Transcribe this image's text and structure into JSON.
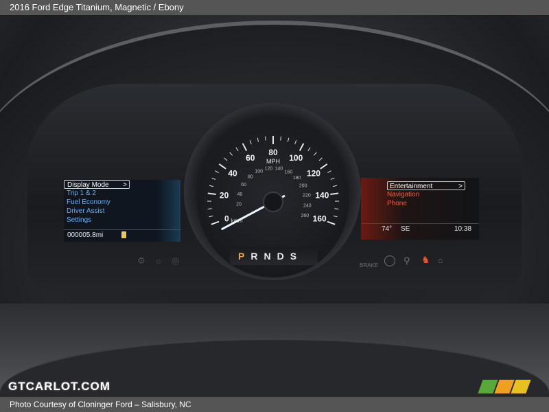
{
  "header": {
    "title": "2016 Ford Edge Titanium,   Magnetic / Ebony"
  },
  "footer": {
    "credit": "Photo Courtesy of Cloninger Ford – Salisbury, NC"
  },
  "watermark": {
    "text": "GTCARLOT.COM"
  },
  "left_display": {
    "menu": [
      "Display Mode",
      "Trip 1 & 2",
      "Fuel Economy",
      "Driver Assist",
      "Settings"
    ],
    "selected_chevron": ">",
    "odometer": "000005.8mi"
  },
  "right_display": {
    "menu": [
      "Entertainment",
      "Navigation",
      "Phone"
    ],
    "selected_chevron": ">",
    "temperature": "74°",
    "heading": "SE",
    "clock": "10:38"
  },
  "speedometer": {
    "unit": "MPH",
    "secondary_unit": "km/h",
    "mph_labels": [
      "0",
      "20",
      "40",
      "60",
      "80",
      "100",
      "120",
      "140",
      "160"
    ],
    "kmh_labels": [
      "20",
      "40",
      "60",
      "80",
      "100",
      "120",
      "140",
      "160",
      "180",
      "200",
      "220",
      "240",
      "260"
    ],
    "speed_mph": 0,
    "max_mph": 160
  },
  "gear_selector": {
    "gears": [
      "P",
      "R",
      "N",
      "D",
      "S"
    ],
    "selected": "P"
  },
  "tell_tales": {
    "brake_label": "BRAKE"
  },
  "colors": {
    "accent_blue": "#5fb2ff",
    "accent_red": "#ff5a3c",
    "needle": "#e8f6ff",
    "gear_selected": "#f3a93b"
  }
}
